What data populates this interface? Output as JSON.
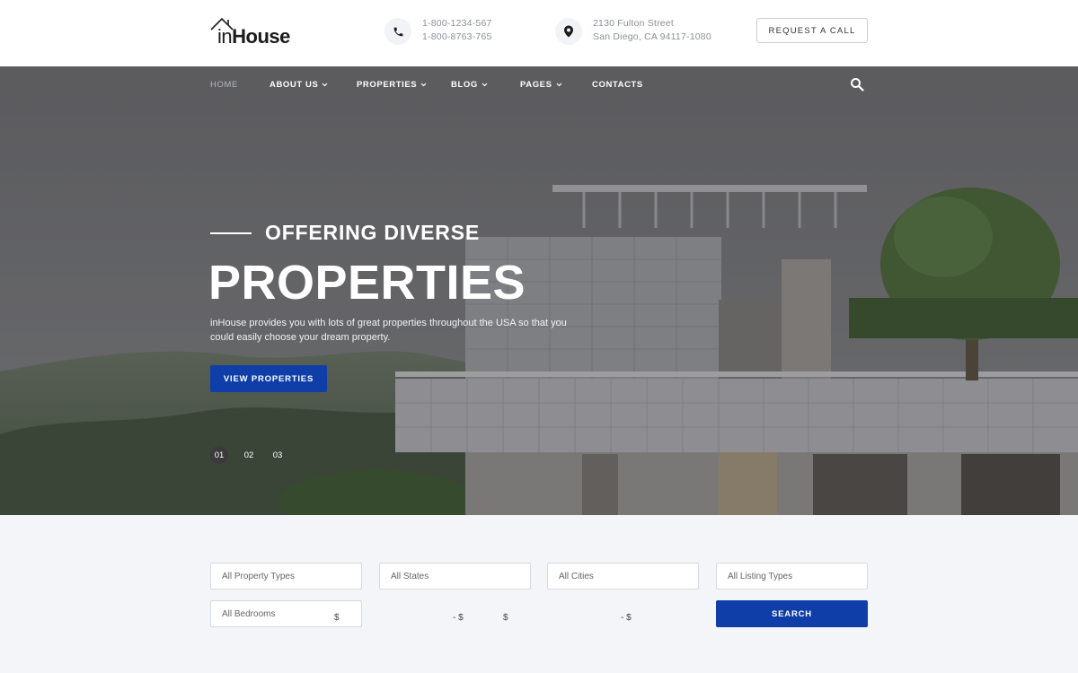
{
  "header": {
    "logo": {
      "prefix": "in",
      "suffix": "House"
    },
    "phones": [
      "1-800-1234-567",
      "1-800-8763-765"
    ],
    "address": [
      "2130 Fulton Street",
      "San Diego, CA 94117-1080"
    ],
    "request_label": "REQUEST A CALL"
  },
  "nav": {
    "items": [
      {
        "label": "HOME",
        "active": true,
        "dropdown": false
      },
      {
        "label": "ABOUT US",
        "active": false,
        "dropdown": true
      },
      {
        "label": "PROPERTIES",
        "active": false,
        "dropdown": true
      },
      {
        "label": "BLOG",
        "active": false,
        "dropdown": true
      },
      {
        "label": "PAGES",
        "active": false,
        "dropdown": true
      },
      {
        "label": "CONTACTS",
        "active": false,
        "dropdown": false
      }
    ],
    "search_icon": "search-icon"
  },
  "hero": {
    "kicker": "OFFERING DIVERSE",
    "title": "PROPERTIES",
    "text": "inHouse provides you with lots of great properties throughout the USA so that you could easily choose your dream property.",
    "button_label": "VIEW PROPERTIES",
    "slides": [
      "01",
      "02",
      "03"
    ],
    "active_slide": "01"
  },
  "search_form": {
    "property_types": "All Property Types",
    "states": "All States",
    "cities": "All Cities",
    "listing_types": "All Listing Types",
    "bedrooms": "All Bedrooms",
    "price_currency_1": "$",
    "price_sep_1": "- $",
    "price_currency_2": "$",
    "price_sep_2": "- $",
    "search_label": "SEARCH"
  },
  "colors": {
    "accent": "#0f3ea8",
    "nav_bg": "#5c5c5f",
    "page_bg": "#f4f5f8"
  }
}
